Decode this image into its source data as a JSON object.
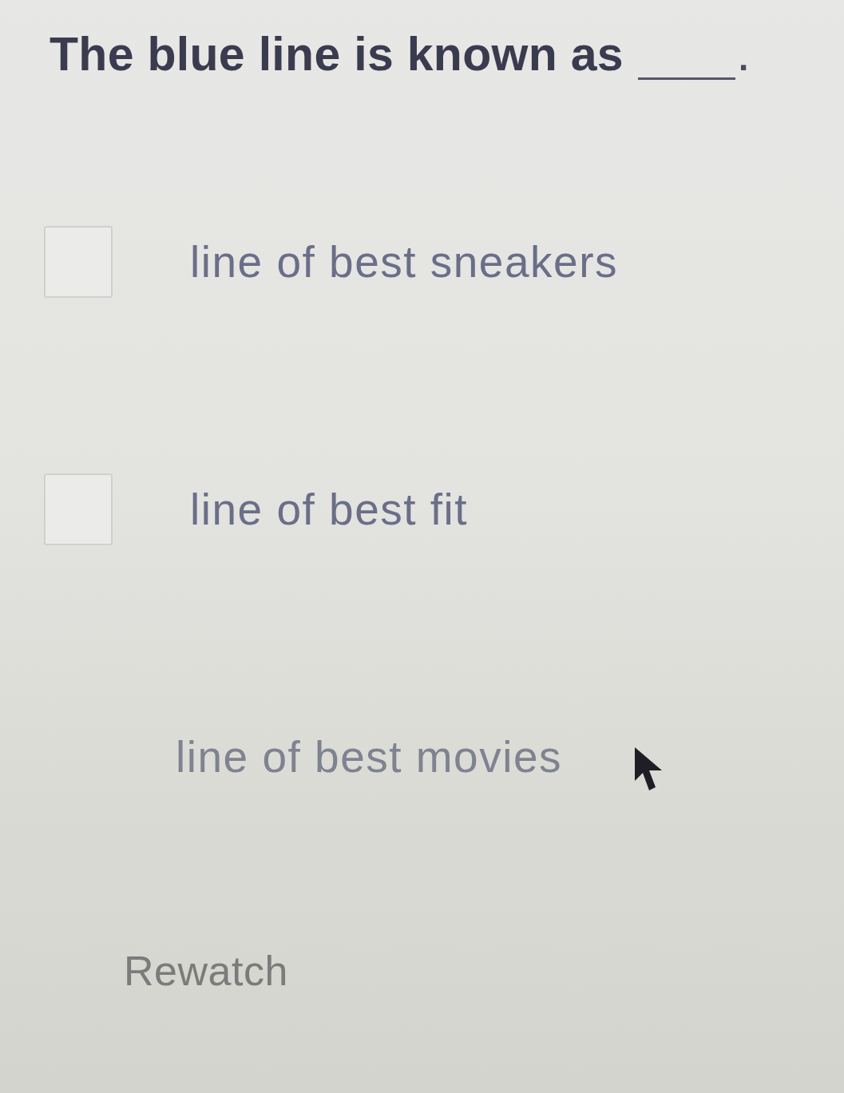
{
  "question": {
    "text": "The blue line is known as",
    "end": "."
  },
  "options": [
    {
      "kind": "checkbox",
      "label": "line of best sneakers",
      "checked": false
    },
    {
      "kind": "checkbox",
      "label": "line of best fit",
      "checked": false
    },
    {
      "kind": "plain",
      "label": "line of best movies"
    }
  ],
  "rewatch": "Rewatch"
}
